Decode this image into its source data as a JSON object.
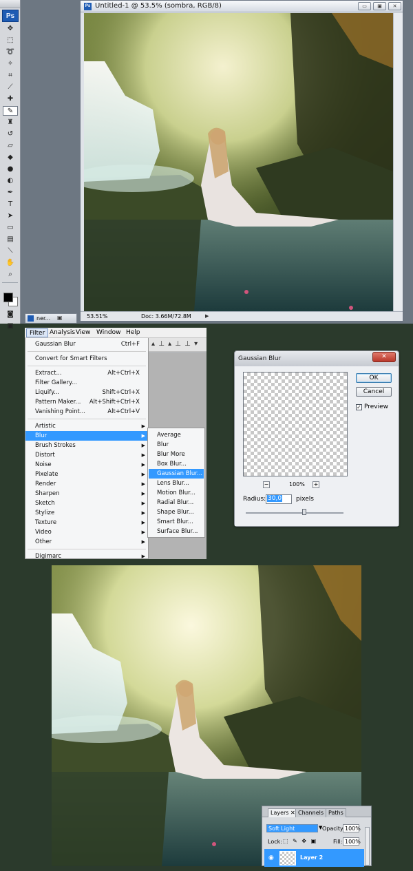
{
  "toolbox": {
    "app_logo": "Ps",
    "tools": [
      {
        "name": "move-tool",
        "glyph": "✥"
      },
      {
        "name": "marquee-tool",
        "glyph": "⬚"
      },
      {
        "name": "lasso-tool",
        "glyph": "➰"
      },
      {
        "name": "magic-wand-tool",
        "glyph": "✧"
      },
      {
        "name": "crop-tool",
        "glyph": "⌗"
      },
      {
        "name": "slice-tool",
        "glyph": "⟋"
      },
      {
        "name": "healing-brush-tool",
        "glyph": "✚"
      },
      {
        "name": "brush-tool",
        "glyph": "✎",
        "active": true
      },
      {
        "name": "clone-stamp-tool",
        "glyph": "♜"
      },
      {
        "name": "history-brush-tool",
        "glyph": "↺"
      },
      {
        "name": "eraser-tool",
        "glyph": "▱"
      },
      {
        "name": "paint-bucket-tool",
        "glyph": "◆"
      },
      {
        "name": "blur-tool",
        "glyph": "●"
      },
      {
        "name": "dodge-tool",
        "glyph": "◐"
      },
      {
        "name": "pen-tool",
        "glyph": "✒"
      },
      {
        "name": "type-tool",
        "glyph": "T"
      },
      {
        "name": "path-selection-tool",
        "glyph": "➤"
      },
      {
        "name": "shape-tool",
        "glyph": "▭"
      },
      {
        "name": "notes-tool",
        "glyph": "▤"
      },
      {
        "name": "eyedropper-tool",
        "glyph": "⟍"
      },
      {
        "name": "hand-tool",
        "glyph": "✋"
      },
      {
        "name": "zoom-tool",
        "glyph": "⌕"
      }
    ],
    "bottom_tools": [
      {
        "name": "quick-mask-icon",
        "glyph": "◙"
      },
      {
        "name": "screen-mode-icon",
        "glyph": "▣"
      }
    ]
  },
  "document": {
    "title": "Untitled-1 @ 53.5% (sombra, RGB/8)",
    "zoom": "53.51%",
    "doc_info": "Doc: 3.66M/72.8M",
    "minimize_glyph": "▭",
    "restore_glyph": "▣",
    "close_glyph": "✕"
  },
  "minimized_tab": {
    "label": "ner..."
  },
  "menubar": {
    "items": [
      "Filter",
      "Analysis",
      "View",
      "Window",
      "Help"
    ],
    "active": "Filter",
    "right_strip_icons": "▴ ⊥ ▴ ⊥ ⊥ ▾"
  },
  "filter_menu": {
    "items": [
      {
        "label": "Gaussian Blur",
        "shortcut": "Ctrl+F"
      },
      {
        "sep": true
      },
      {
        "label": "Convert for Smart Filters",
        "shortcut": ""
      },
      {
        "sep": true
      },
      {
        "label": "Extract...",
        "shortcut": "Alt+Ctrl+X"
      },
      {
        "label": "Filter Gallery...",
        "shortcut": ""
      },
      {
        "label": "Liquify...",
        "shortcut": "Shift+Ctrl+X"
      },
      {
        "label": "Pattern Maker...",
        "shortcut": "Alt+Shift+Ctrl+X"
      },
      {
        "label": "Vanishing Point...",
        "shortcut": "Alt+Ctrl+V"
      },
      {
        "sep": true
      },
      {
        "label": "Artistic",
        "submenu": true
      },
      {
        "label": "Blur",
        "submenu": true,
        "highlighted": true
      },
      {
        "label": "Brush Strokes",
        "submenu": true
      },
      {
        "label": "Distort",
        "submenu": true
      },
      {
        "label": "Noise",
        "submenu": true
      },
      {
        "label": "Pixelate",
        "submenu": true
      },
      {
        "label": "Render",
        "submenu": true
      },
      {
        "label": "Sharpen",
        "submenu": true
      },
      {
        "label": "Sketch",
        "submenu": true
      },
      {
        "label": "Stylize",
        "submenu": true
      },
      {
        "label": "Texture",
        "submenu": true
      },
      {
        "label": "Video",
        "submenu": true
      },
      {
        "label": "Other",
        "submenu": true
      },
      {
        "sep": true
      },
      {
        "label": "Digimarc",
        "submenu": true
      }
    ],
    "submenu_arrow": "▶"
  },
  "blur_submenu": {
    "items": [
      {
        "label": "Average"
      },
      {
        "label": "Blur"
      },
      {
        "label": "Blur More"
      },
      {
        "label": "Box Blur..."
      },
      {
        "label": "Gaussian Blur...",
        "highlighted": true
      },
      {
        "label": "Lens Blur..."
      },
      {
        "label": "Motion Blur..."
      },
      {
        "label": "Radial Blur..."
      },
      {
        "label": "Shape Blur..."
      },
      {
        "label": "Smart Blur..."
      },
      {
        "label": "Surface Blur..."
      }
    ]
  },
  "gaussian_blur_dialog": {
    "title": "Gaussian Blur",
    "close_glyph": "✕",
    "ok_label": "OK",
    "cancel_label": "Cancel",
    "preview_label": "Preview",
    "preview_checked": true,
    "check_glyph": "✓",
    "zoom_out_glyph": "−",
    "zoom_in_glyph": "+",
    "zoom_level": "100%",
    "radius_label": "Radius:",
    "radius_value": "30,0",
    "radius_units": "pixels",
    "slider_level": 0.6
  },
  "layers_panel": {
    "tabs": [
      {
        "label": "Layers ✕",
        "active": true
      },
      {
        "label": "Channels"
      },
      {
        "label": "Paths"
      }
    ],
    "blend_mode": "Soft Light",
    "dropdown_glyph": "▼",
    "opacity_label": "Opacity:",
    "opacity_value": "100%",
    "lock_label": "Lock:",
    "lock_icons": "⬚ ✎ ✥ ▣",
    "fill_label": "Fill:",
    "fill_value": "100%",
    "eye_glyph": "◉",
    "layer_name": "Layer 2"
  },
  "colors": {
    "highlight": "#3399ff",
    "photoshop_blue": "#1e5bb3",
    "background": "#2b3a2c",
    "close_red": "#c4473a"
  }
}
